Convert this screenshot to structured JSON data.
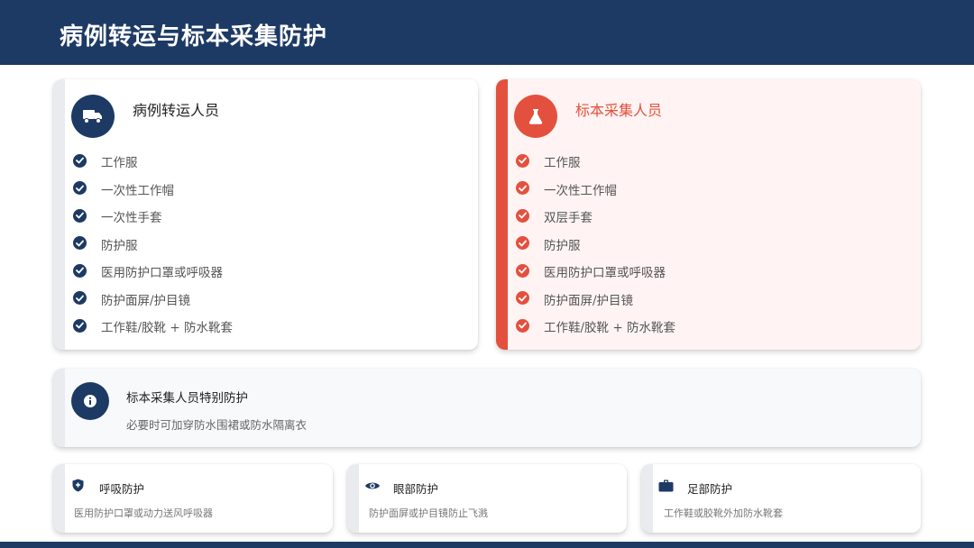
{
  "header": {
    "title": "病例转运与标本采集防护"
  },
  "transport": {
    "title": "病例转运人员",
    "icon": "truck-icon",
    "items": [
      "工作服",
      "一次性工作帽",
      "一次性手套",
      "防护服",
      "医用防护口罩或呼吸器",
      "防护面屏/护目镜",
      "工作鞋/胶靴 + 防水靴套"
    ]
  },
  "sampling": {
    "title": "标本采集人员",
    "icon": "flask-icon",
    "items": [
      "工作服",
      "一次性工作帽",
      "双层手套",
      "防护服",
      "医用防护口罩或呼吸器",
      "防护面屏/护目镜",
      "工作鞋/胶靴 + 防水靴套"
    ]
  },
  "special": {
    "icon": "info-icon",
    "title": "标本采集人员特别防护",
    "desc": "必要时可加穿防水围裙或防水隔离衣"
  },
  "tips": [
    {
      "icon": "shield-icon",
      "title": "呼吸防护",
      "desc": "医用防护口罩或动力送风呼吸器"
    },
    {
      "icon": "eye-icon",
      "title": "眼部防护",
      "desc": "防护面屏或护目镜防止飞溅"
    },
    {
      "icon": "briefcase-icon",
      "title": "足部防护",
      "desc": "工作鞋或胶靴外加防水靴套"
    }
  ],
  "colors": {
    "navy": "#1d3a64",
    "red": "#e4503e",
    "red_bg": "#fff4f3"
  }
}
